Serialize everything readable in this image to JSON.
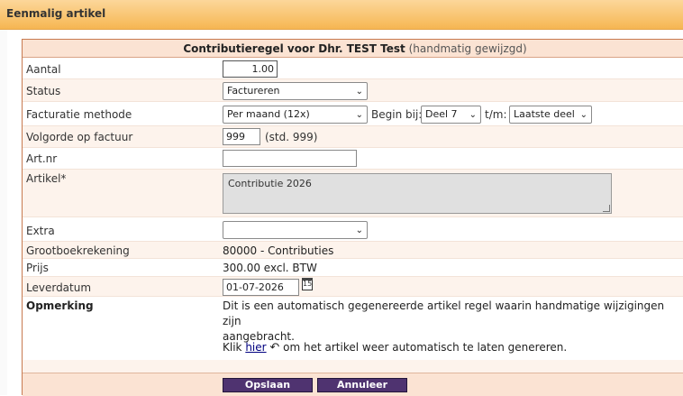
{
  "window": {
    "title": "Eenmalig artikel"
  },
  "form": {
    "header_title": "Contributieregel voor Dhr. TEST Test",
    "header_hint": "(handmatig gewijzgd)",
    "aantal": {
      "label": "Aantal",
      "value": "1.00"
    },
    "status": {
      "label": "Status",
      "selected": "Factureren"
    },
    "facturatie": {
      "label": "Facturatie methode",
      "selected": "Per maand (12x)",
      "begin_label": "Begin bij:",
      "begin_selected": "Deel 7",
      "tm_label": "t/m:",
      "tm_selected": "Laatste deel"
    },
    "volgorde": {
      "label": "Volgorde op factuur",
      "value": "999",
      "hint": "(std. 999)"
    },
    "artnr": {
      "label": "Art.nr",
      "value": ""
    },
    "artikel": {
      "label": "Artikel*",
      "value": "Contributie 2026"
    },
    "extra": {
      "label": "Extra",
      "selected": ""
    },
    "grootboek": {
      "label": "Grootboekrekening",
      "value": "80000 - Contributies"
    },
    "prijs": {
      "label": "Prijs",
      "value": "300.00 excl. BTW"
    },
    "leverdatum": {
      "label": "Leverdatum",
      "value": "01-07-2026",
      "calendar_glyph": "15"
    },
    "opmerking": {
      "label": "Opmerking",
      "line1": "Dit is een automatisch gegenereerde artikel regel waarin handmatige wijzigingen zijn",
      "line2": "aangebracht.",
      "klik": "Klik",
      "hier": "hier",
      "rest": "om het artikel weer automatisch te laten genereren.",
      "undo_glyph": "↶"
    }
  },
  "buttons": {
    "save": "Opslaan",
    "cancel": "Annuleer"
  },
  "colors": {
    "titlebar": "#f6b652",
    "frame_border": "#c77a50",
    "header_bg": "#fbe3d3",
    "row_shade": "#fdf3ec",
    "button_bg": "#4f3370",
    "link": "#000080"
  }
}
